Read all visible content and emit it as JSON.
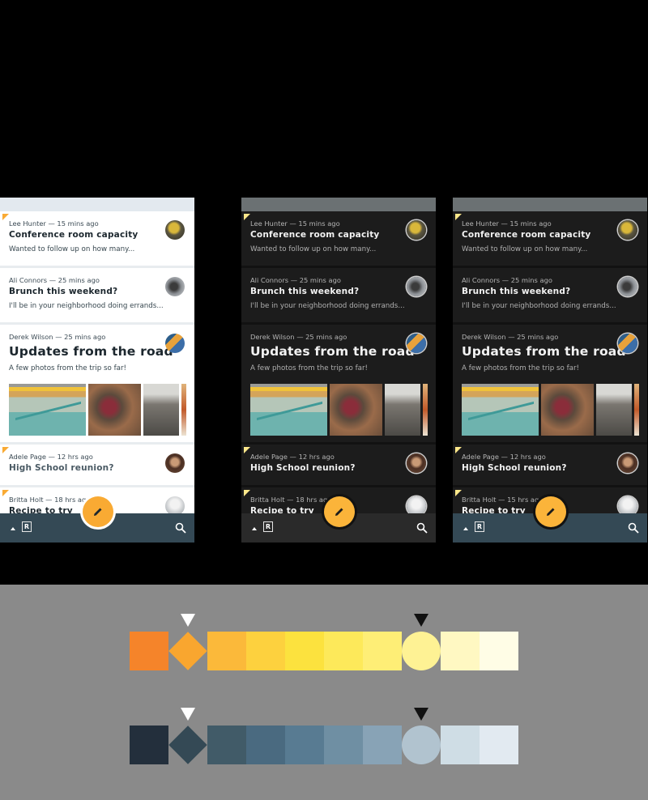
{
  "phones": [
    {
      "theme": "light",
      "messages": [
        {
          "sender": "Lee Hunter",
          "time": "15 mins ago",
          "meta": "Lee Hunter — 15 mins ago",
          "subject": "Conference room capacity",
          "snippet": "Wanted to follow up on how many...",
          "unread": true,
          "avatar": "avatar-lee-hunter"
        },
        {
          "sender": "Ali Connors",
          "time": "25 mins ago",
          "meta": "Ali Connors — 25 mins ago",
          "subject": "Brunch this weekend?",
          "snippet": "I'll be in your neighborhood doing errands...",
          "unread": false,
          "avatar": "avatar-ali-connors"
        },
        {
          "sender": "Derek Wilson",
          "time": "25 mins ago",
          "meta": "Derek Wilson — 25 mins ago",
          "subject": "Updates from the road",
          "snippet": "A few photos from the trip so far!",
          "unread": false,
          "avatar": "avatar-derek-wilson",
          "photos": [
            "photo-stairway",
            "photo-market",
            "photo-street",
            "photo-partial"
          ]
        },
        {
          "sender": "Adele Page",
          "time": "12 hrs ago",
          "meta": "Adele Page — 12 hrs ago",
          "subject": "High School reunion?",
          "snippet": "",
          "unread": true,
          "avatar": "avatar-adele-page"
        },
        {
          "sender": "Britta Holt",
          "time": "18 hrs ago",
          "meta": "Britta Holt — 18 hrs ago",
          "subject": "Recipe to try",
          "snippet": "",
          "unread": true,
          "avatar": "avatar-britta-holt"
        }
      ]
    },
    {
      "theme": "dark",
      "messages": [
        {
          "meta": "Lee Hunter — 15 mins ago",
          "subject": "Conference room capacity",
          "snippet": "Wanted to follow up on how many..."
        },
        {
          "meta": "Ali Connors — 25 mins ago",
          "subject": "Brunch this weekend?",
          "snippet": "I'll be in your neighborhood doing errands..."
        },
        {
          "meta": "Derek Wilson — 25 mins ago",
          "subject": "Updates from the road",
          "snippet": "A few photos from the trip so far!"
        },
        {
          "meta": "Adele Page — 12 hrs ago",
          "subject": "High School reunion?",
          "snippet": ""
        },
        {
          "meta": "Britta Holt — 18 hrs ago",
          "subject": "Recipe to try",
          "snippet": ""
        }
      ]
    },
    {
      "theme": "dark-slate-bar",
      "messages": [
        {
          "meta": "Lee Hunter — 15 mins ago",
          "subject": "Conference room capacity",
          "snippet": "Wanted to follow up on how many..."
        },
        {
          "meta": "Ali Connors — 25 mins ago",
          "subject": "Brunch this weekend?",
          "snippet": "I'll be in your neighborhood doing errands..."
        },
        {
          "meta": "Derek Wilson — 25 mins ago",
          "subject": "Updates from the road",
          "snippet": "A few photos from the trip so far!"
        },
        {
          "meta": "Adele Page — 12 hrs ago",
          "subject": "High School reunion?",
          "snippet": ""
        },
        {
          "meta": "Britta Holt — 15 hrs ago",
          "subject": "Recipe to try",
          "snippet": ""
        }
      ]
    }
  ],
  "bottom_bar": {
    "logo_letter": "R",
    "icons": [
      "chevron-up-icon",
      "reply-logo-icon",
      "search-icon"
    ],
    "fab_icon": "pencil-icon"
  },
  "palettes": {
    "yellow": {
      "colors": [
        "#f5842a",
        "#f9a62f",
        "#fbb93a",
        "#fdd13e",
        "#fce23e",
        "#fde95a",
        "#feee76",
        "#fef294",
        "#fff8c2",
        "#fffde6"
      ],
      "shapes": [
        "square",
        "diamond",
        "square",
        "square",
        "square",
        "square",
        "square",
        "circle",
        "square",
        "square"
      ],
      "marker_white_index": 1,
      "marker_dark_index": 7
    },
    "slate": {
      "colors": [
        "#232f3c",
        "#344955",
        "#415b68",
        "#4a6a80",
        "#587b92",
        "#6f8fa3",
        "#88a3b6",
        "#b1c3cf",
        "#cfdde5",
        "#e2eaf1"
      ],
      "shapes": [
        "square",
        "diamond",
        "square",
        "square",
        "square",
        "square",
        "square",
        "circle",
        "square",
        "square"
      ],
      "marker_white_index": 1,
      "marker_dark_index": 7
    }
  },
  "colors": {
    "accent": "#f9aa33",
    "primary": "#344955",
    "dark_surface": "#121212"
  }
}
